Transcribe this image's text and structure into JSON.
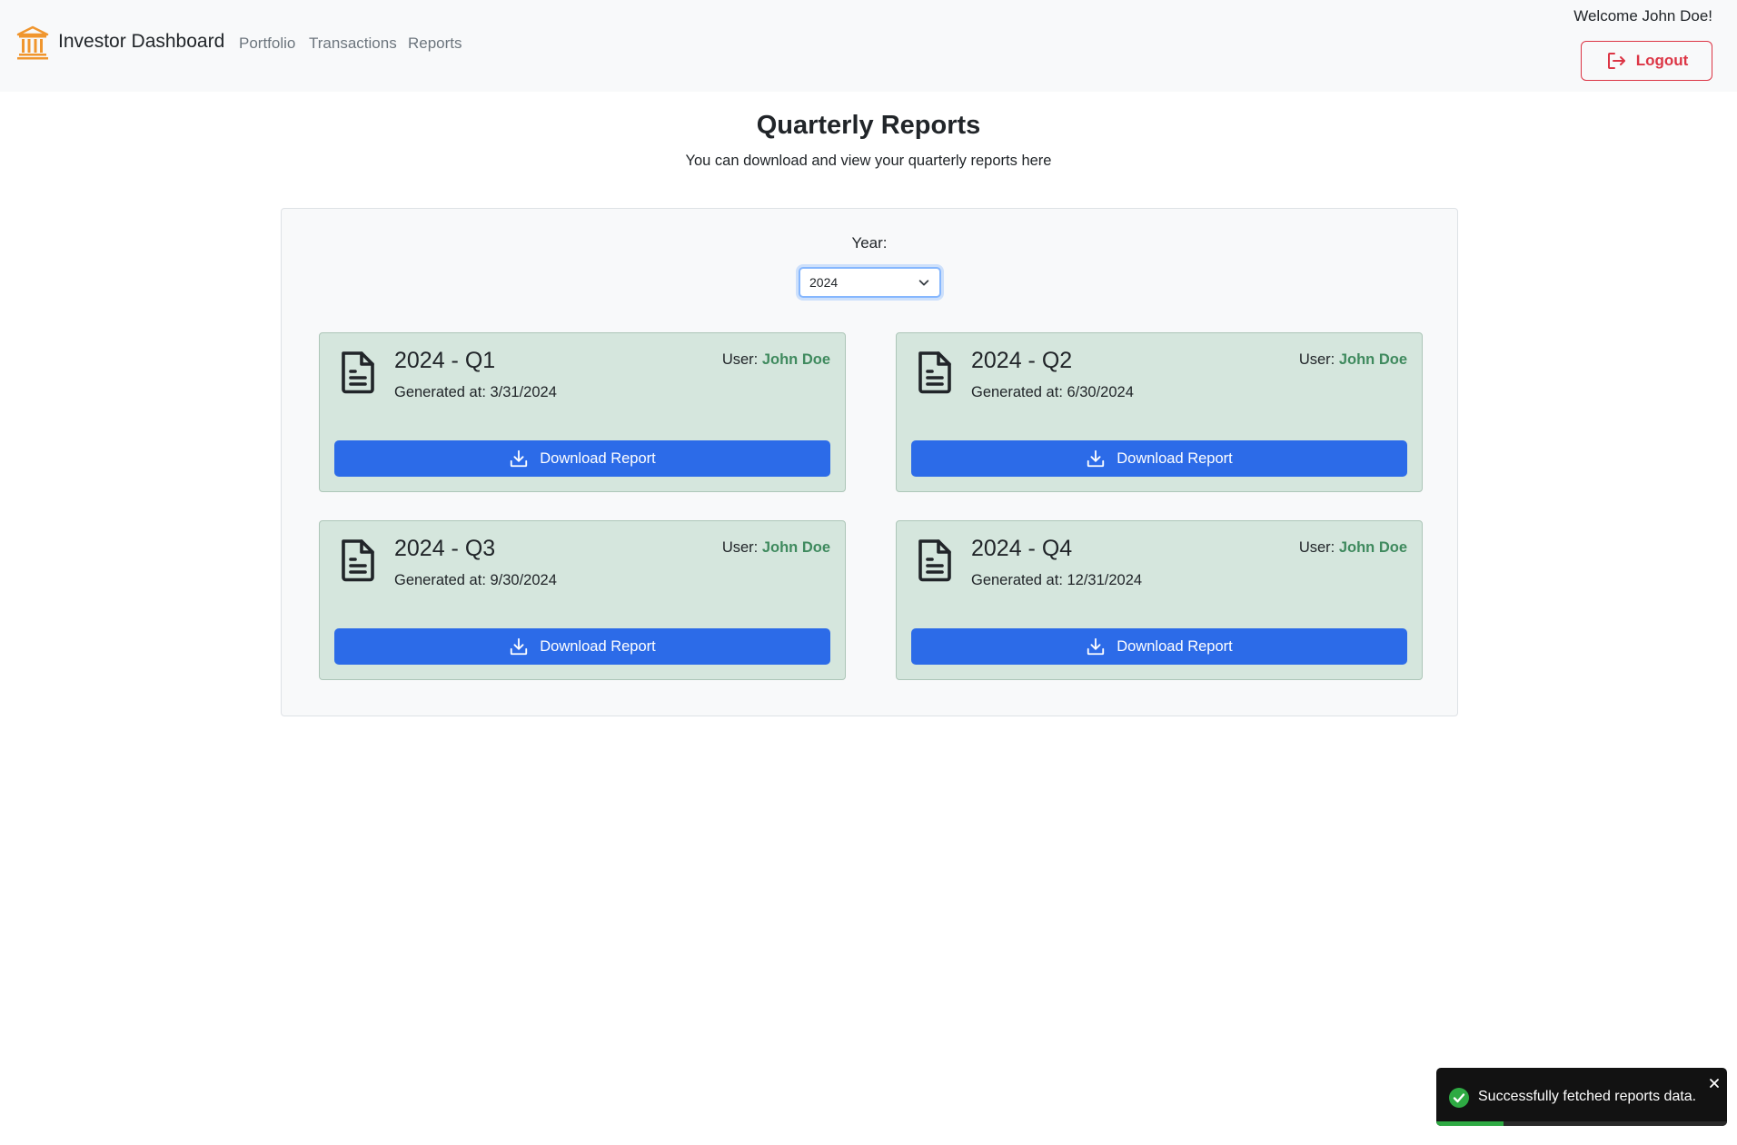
{
  "navbar": {
    "brand": "Investor Dashboard",
    "brand_icon": "bank-icon",
    "links": [
      "Portfolio",
      "Transactions",
      "Reports"
    ],
    "welcome": "Welcome John Doe!",
    "logout_label": "Logout",
    "logout_icon": "logout-icon"
  },
  "header": {
    "title": "Quarterly Reports",
    "subtitle": "You can download and view your quarterly reports here"
  },
  "filter": {
    "year_label": "Year:",
    "year_value": "2024"
  },
  "reports": [
    {
      "title": "2024 - Q1",
      "generated": "Generated at: 3/31/2024",
      "user_label": "User:",
      "user_name": "John Doe",
      "button": "Download Report"
    },
    {
      "title": "2024 - Q2",
      "generated": "Generated at: 6/30/2024",
      "user_label": "User:",
      "user_name": "John Doe",
      "button": "Download Report"
    },
    {
      "title": "2024 - Q3",
      "generated": "Generated at: 9/30/2024",
      "user_label": "User:",
      "user_name": "John Doe",
      "button": "Download Report"
    },
    {
      "title": "2024 - Q4",
      "generated": "Generated at: 12/31/2024",
      "user_label": "User:",
      "user_name": "John Doe",
      "button": "Download Report"
    }
  ],
  "toast": {
    "message": "Successfully fetched reports data.",
    "progress": 0.23,
    "status": "success"
  },
  "colors": {
    "brand_orange": "#f0962e",
    "primary_blue": "#2c6be8",
    "danger_red": "#dc3545",
    "card_green": "#d5e6dd",
    "user_green": "#3f8a5e",
    "toast_green": "#2eaa43"
  }
}
